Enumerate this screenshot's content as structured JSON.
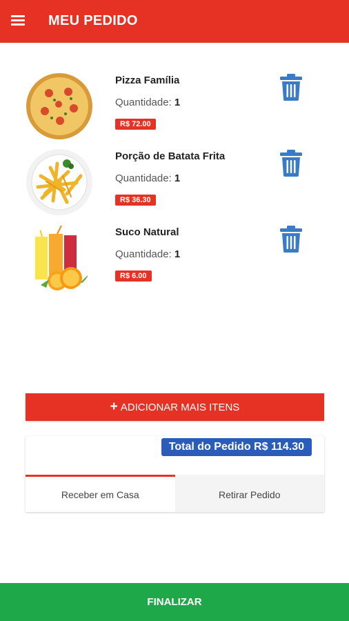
{
  "header": {
    "title": "MEU PEDIDO",
    "menu_icon": "hamburger-menu-icon"
  },
  "items": [
    {
      "name": "Pizza Família",
      "qty_label": "Quantidade:",
      "qty": "1",
      "price": "R$ 72.00",
      "image": "pizza-image",
      "delete_icon": "trash-icon"
    },
    {
      "name": "Porção de Batata Frita",
      "qty_label": "Quantidade:",
      "qty": "1",
      "price": "R$ 36.30",
      "image": "fries-image",
      "delete_icon": "trash-icon"
    },
    {
      "name": "Suco Natural",
      "qty_label": "Quantidade:",
      "qty": "1",
      "price": "R$ 6.00",
      "image": "juice-image",
      "delete_icon": "trash-icon"
    }
  ],
  "add_more": {
    "icon": "plus-icon",
    "label": "ADICIONAR MAIS ITENS"
  },
  "summary": {
    "total_label": "Total do Pedido R$ 114.30"
  },
  "tabs": [
    {
      "label": "Receber em Casa",
      "active": true
    },
    {
      "label": "Retirar Pedido",
      "active": false
    }
  ],
  "footer": {
    "finalize_label": "FINALIZAR"
  },
  "colors": {
    "primary_red": "#e53224",
    "blue": "#2c5cb9",
    "green": "#1fa84a",
    "trash_blue": "#3a7bc8"
  }
}
